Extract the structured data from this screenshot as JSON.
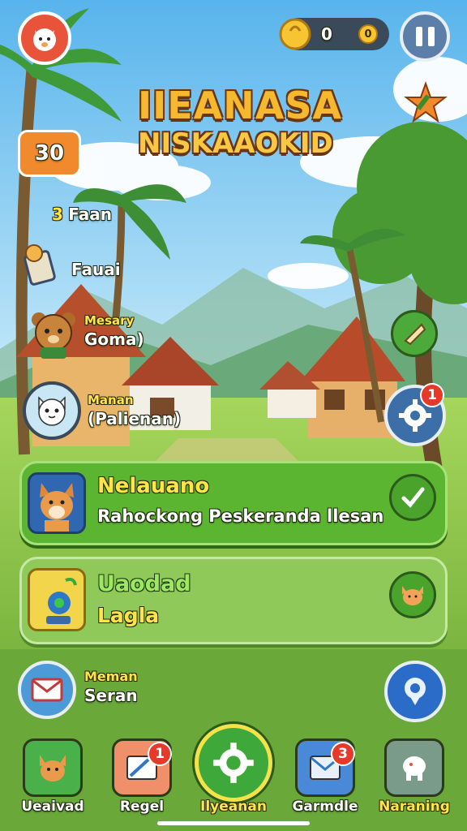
{
  "header": {
    "coin_count": "0",
    "token_count": "0",
    "title_line1": "IIEANASA",
    "title_line2": "NISKAAOKID",
    "level_value": "30"
  },
  "side_menu": {
    "item1_count": "3",
    "item1_label": "Faan",
    "item2_label": "Fauai",
    "item3_label1": "Mesary",
    "item3_label2": "Goma)",
    "item4_label1": "Manan",
    "item4_label2": "(Palienan)"
  },
  "gear_badge": "1",
  "cards": [
    {
      "title": "Nelauano",
      "subtitle": "Rahockong Peskeranda llesan"
    },
    {
      "title": "Uaodad",
      "subtitle": "Lagla"
    }
  ],
  "mail": {
    "label1": "Meman",
    "label2": "Seran"
  },
  "bottom_nav": [
    {
      "label": "Ueaivad",
      "icon": "cat-icon",
      "badge": ""
    },
    {
      "label": "Regel",
      "icon": "envelope-icon",
      "badge": "1"
    },
    {
      "label": "Ilyeanan",
      "icon": "gear-icon",
      "badge": ""
    },
    {
      "label": "Garmdle",
      "icon": "mail-icon",
      "badge": "3"
    },
    {
      "label": "Naraning",
      "icon": "elephant-icon",
      "badge": ""
    }
  ],
  "colors": {
    "sky": "#7cc6ee",
    "grass": "#7fbf3a",
    "card_green": "#5cb531",
    "accent_orange": "#f08a2c",
    "badge_red": "#e53a2a",
    "title_yellow": "#f5b82e"
  }
}
